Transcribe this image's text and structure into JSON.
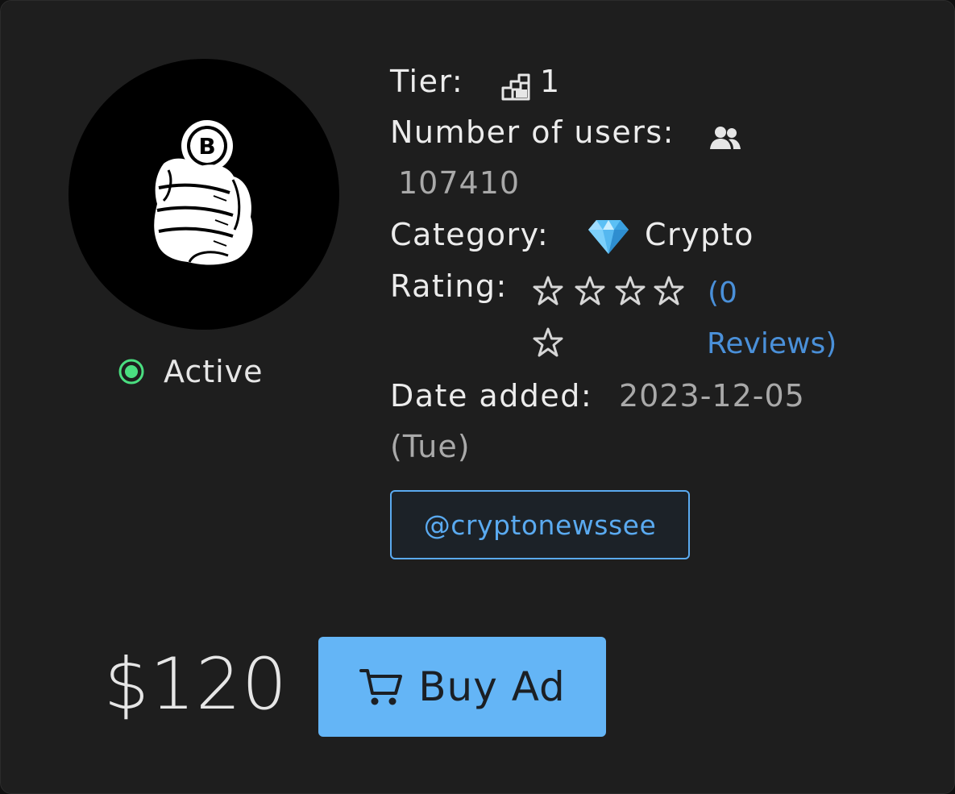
{
  "status": {
    "label": "Active",
    "color": "#4ade80"
  },
  "details": {
    "tier_label": "Tier:",
    "tier_value": "1",
    "tier_icon": "stairs-icon",
    "users_label": "Number of users:",
    "users_icon": "users-icon",
    "users_value": "107410",
    "category_label": "Category:",
    "category_icon": "gem-icon",
    "category_value": "Crypto",
    "rating_label": "Rating:",
    "rating_stars_filled": 0,
    "rating_stars_total": 5,
    "reviews_line1": "(0",
    "reviews_line2": "Reviews)",
    "date_label": "Date added:",
    "date_value": "2023-12-05",
    "date_weekday": "(Tue)"
  },
  "handle": "@cryptonewssee",
  "price": "$120",
  "buy_button": {
    "label": "Buy Ad",
    "icon": "cart-icon"
  },
  "colors": {
    "accent": "#64b5f6",
    "link": "#4a90d9",
    "card_bg": "#1e1e1e"
  }
}
